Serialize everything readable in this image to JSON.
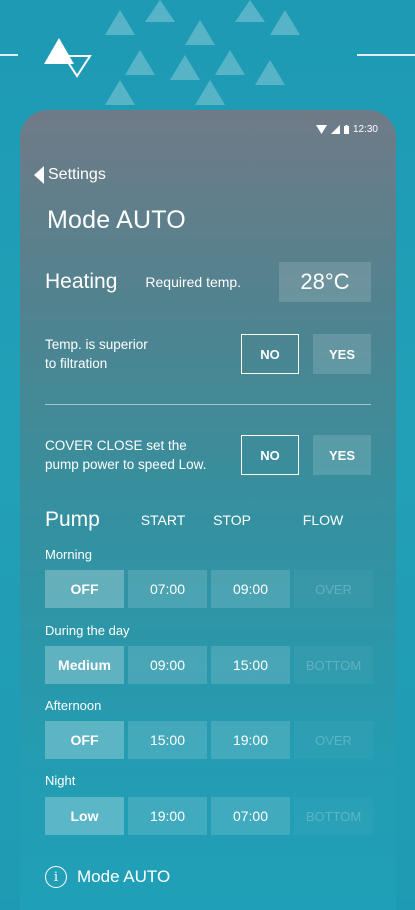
{
  "status_bar": {
    "time": "12:30"
  },
  "nav": {
    "back_label": "Settings"
  },
  "page": {
    "title": "Mode AUTO"
  },
  "heating": {
    "label": "Heating",
    "required_label": "Required temp.",
    "required_value": "28°C"
  },
  "options": [
    {
      "text_line1": "Temp. is superior",
      "text_line2": "to filtration",
      "no": "NO",
      "yes": "YES",
      "selected": "NO"
    },
    {
      "text_line1": "COVER CLOSE set the",
      "text_line2": "pump power to speed Low.",
      "no": "NO",
      "yes": "YES",
      "selected": "NO"
    }
  ],
  "pump": {
    "title": "Pump",
    "columns": [
      "START",
      "STOP",
      "FLOW"
    ],
    "periods": [
      {
        "label": "Morning",
        "mode": "OFF",
        "start": "07:00",
        "stop": "09:00",
        "flow": "OVER"
      },
      {
        "label": "During the day",
        "mode": "Medium",
        "start": "09:00",
        "stop": "15:00",
        "flow": "BOTTOM"
      },
      {
        "label": "Afternoon",
        "mode": "OFF",
        "start": "15:00",
        "stop": "19:00",
        "flow": "OVER"
      },
      {
        "label": "Night",
        "mode": "Low",
        "start": "19:00",
        "stop": "07:00",
        "flow": "BOTTOM"
      }
    ]
  },
  "footer": {
    "info_label": "Mode AUTO"
  },
  "icons": {
    "back": "chevron-left-icon",
    "wifi": "wifi-icon",
    "signal": "signal-icon",
    "battery": "battery-icon",
    "info": "info-icon",
    "logo": "logo-icon"
  }
}
